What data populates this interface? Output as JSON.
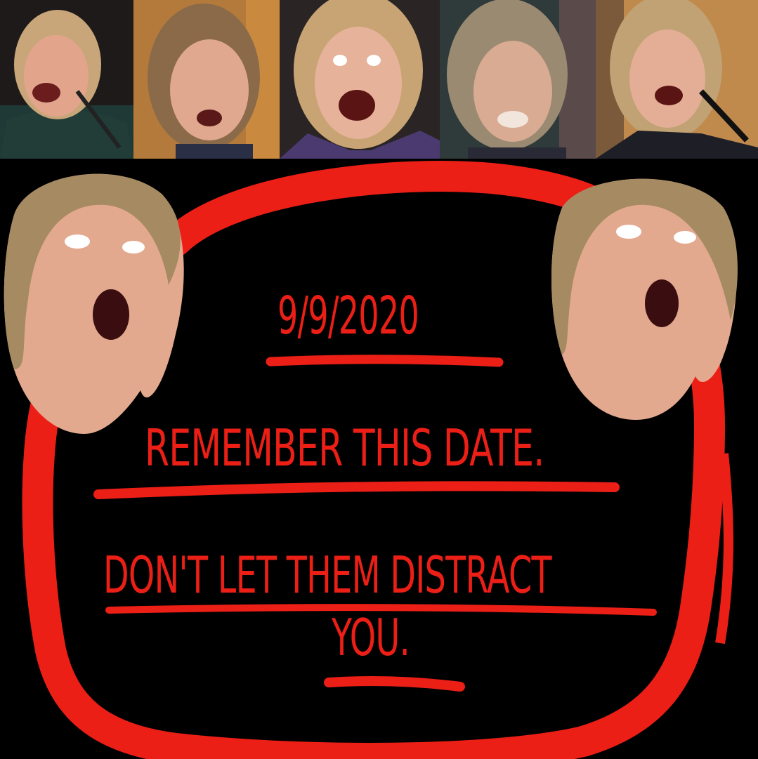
{
  "colors": {
    "background": "#000000",
    "marker_red": "#ec1f17",
    "text_red": "#ec1f17"
  },
  "photo_strip": {
    "photos": [
      {
        "name": "photo-1"
      },
      {
        "name": "photo-2"
      },
      {
        "name": "photo-3"
      },
      {
        "name": "photo-4"
      },
      {
        "name": "photo-5"
      }
    ]
  },
  "message": {
    "date": "9/9/2020",
    "remember": "REMEMBER THIS DATE.",
    "distract_line1": "DON'T LET THEM DISTRACT",
    "distract_line2": "YOU."
  }
}
